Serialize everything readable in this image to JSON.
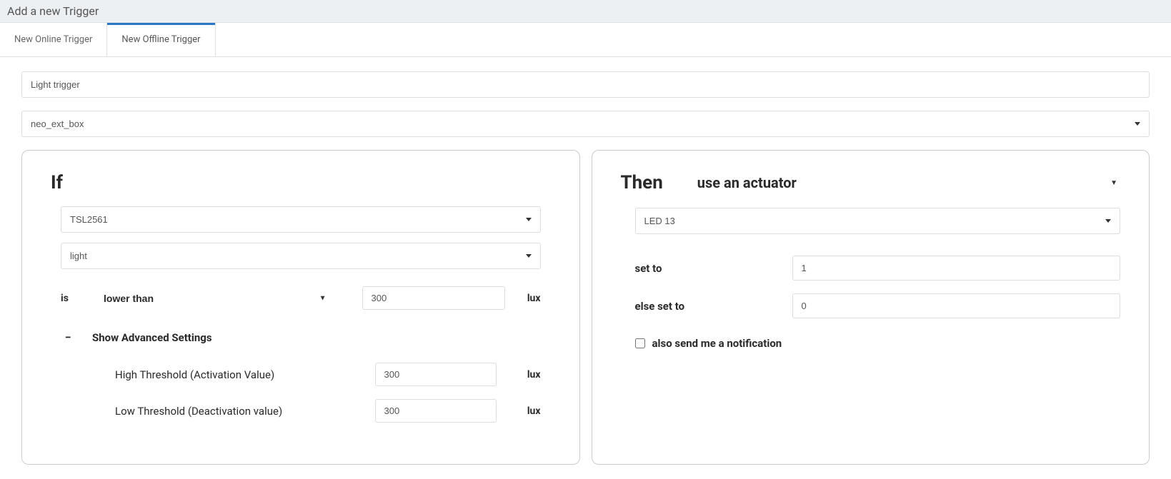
{
  "header": {
    "title": "Add a new Trigger"
  },
  "tabs": {
    "online": "New Online Trigger",
    "offline": "New Offline Trigger"
  },
  "form": {
    "name_value": "Light trigger",
    "device_value": "neo_ext_box"
  },
  "if_panel": {
    "title": "If",
    "sensor_value": "TSL2561",
    "metric_value": "light",
    "is_label": "is",
    "operator_value": "lower than",
    "threshold_value": "300",
    "unit": "lux",
    "advanced": {
      "toggle_icon": "−",
      "label": "Show Advanced Settings",
      "high_label": "High Threshold (Activation Value)",
      "high_value": "300",
      "high_unit": "lux",
      "low_label": "Low Threshold (Deactivation value)",
      "low_value": "300",
      "low_unit": "lux"
    }
  },
  "then_panel": {
    "title": "Then",
    "subtitle": "use an actuator",
    "actuator_value": "LED 13",
    "set_to_label": "set to",
    "set_to_value": "1",
    "else_set_to_label": "else set to",
    "else_set_to_value": "0",
    "notify_label": "also send me a notification"
  }
}
